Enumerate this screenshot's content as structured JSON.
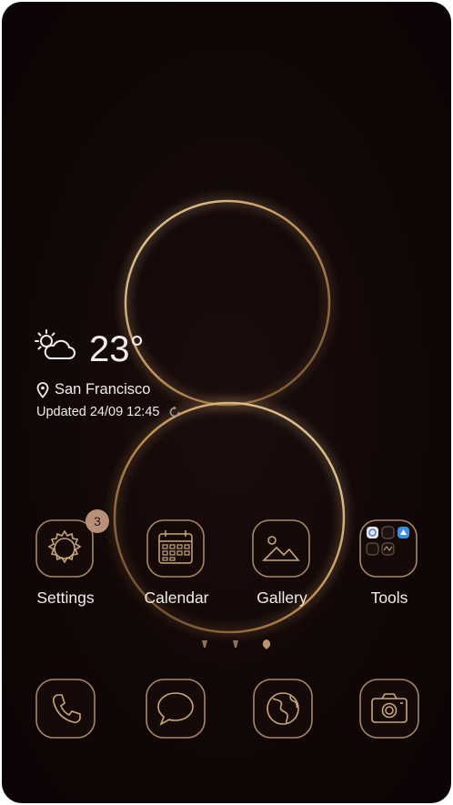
{
  "weather": {
    "temperature": "23°",
    "icon": "partly-cloudy-icon",
    "location": "San Francisco",
    "updated": "Updated 24/09 12:45"
  },
  "apps": [
    {
      "label": "Settings",
      "icon": "gear-icon",
      "badge": "3"
    },
    {
      "label": "Calendar",
      "icon": "calendar-icon"
    },
    {
      "label": "Gallery",
      "icon": "image-icon"
    },
    {
      "label": "Tools",
      "icon": "folder-icon"
    }
  ],
  "dock": [
    {
      "icon": "phone-icon"
    },
    {
      "icon": "message-icon"
    },
    {
      "icon": "browser-globe-icon"
    },
    {
      "icon": "camera-icon"
    }
  ],
  "colors": {
    "background": "#120707",
    "accent_gold": "#d9b27a",
    "text": "#f2ece6",
    "badge": "#b99077"
  }
}
